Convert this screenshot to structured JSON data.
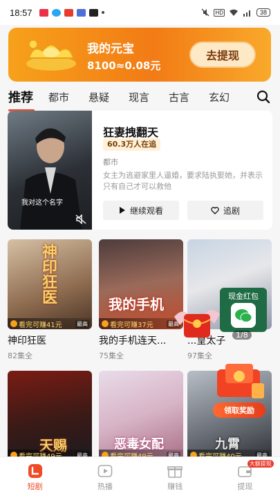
{
  "status_bar": {
    "time": "18:57",
    "battery": "38",
    "icons": [
      "hd-icon",
      "wifi-icon",
      "signal-icon",
      "mute-icon"
    ]
  },
  "banner": {
    "title": "我的元宝",
    "amount": "8100≈0.08元",
    "button": "去提现"
  },
  "tabs": [
    "推荐",
    "都市",
    "悬疑",
    "现言",
    "古言",
    "玄幻"
  ],
  "featured": {
    "title": "狂妻拽翻天",
    "badge": "60.3万人在追",
    "genre": "都市",
    "description": "女主为逃避家里人逼婚，要求陆执娶她，并表示只有自己才可以救他",
    "poster_caption": "我对这个名字",
    "continue_button": "继续观看",
    "follow_button": "追剧"
  },
  "grid": [
    {
      "title": "神印狂医",
      "episodes": "82集全",
      "earn": "看完可赚41元",
      "hot": "最高",
      "poster_text": "神印狂医"
    },
    {
      "title": "我的手机连天...",
      "episodes": "75集全",
      "earn": "看完可赚37元",
      "hot": "最高",
      "poster_text": "我的手机"
    },
    {
      "title": "...皇太子",
      "episodes": "97集全",
      "earn": "",
      "hot": "",
      "poster_text": ""
    },
    {
      "title": "",
      "episodes": "",
      "earn": "看完可赚49元",
      "hot": "最高",
      "poster_text": "天赐"
    },
    {
      "title": "",
      "episodes": "",
      "earn": "看完可赚49元",
      "hot": "最高",
      "poster_text": "恶毒女配"
    },
    {
      "title": "",
      "episodes": "",
      "earn": "看完可赚40元",
      "hot": "最高",
      "poster_text": "九霄"
    }
  ],
  "cash_packet": {
    "label": "现金红包",
    "counter": "1/8"
  },
  "reward": {
    "label": "领取奖励"
  },
  "bottom_nav": [
    {
      "label": "短剧",
      "icon": "short-drama-icon",
      "active": true
    },
    {
      "label": "热播",
      "icon": "play-icon",
      "active": false
    },
    {
      "label": "赚钱",
      "icon": "gift-icon",
      "active": false
    },
    {
      "label": "提现",
      "icon": "wallet-icon",
      "active": false,
      "badge": "大额提现"
    }
  ],
  "colors": {
    "accent": "#f04a27",
    "banner": "#f27b15",
    "badge_bg": "#fff1d9"
  }
}
